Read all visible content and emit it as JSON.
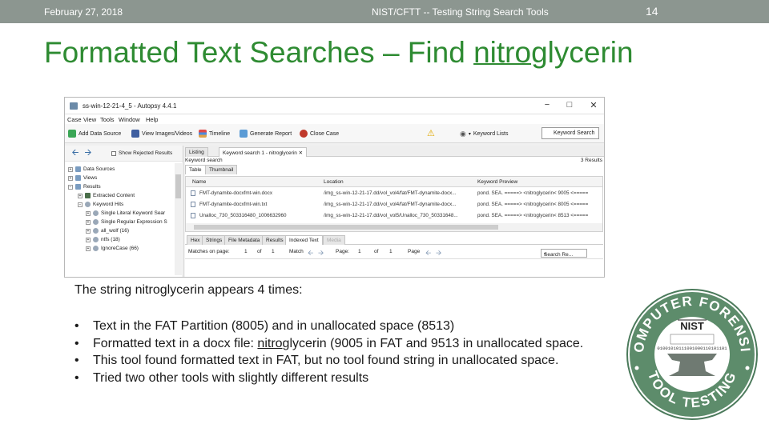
{
  "header": {
    "date": "February 27, 2018",
    "center_text": "NIST/CFTT -- Testing String Search Tools",
    "page_number": "14"
  },
  "title": {
    "prefix": "Formatted Text Searches – Find ",
    "underlined": "nitro",
    "suffix": "glycerin",
    "color": "#2e8b32"
  },
  "autopsy": {
    "window_title": "ss-win-12-21-4_5 - Autopsy 4.4.1",
    "window_controls": [
      "−",
      "□",
      "✕"
    ],
    "menu": [
      "Case",
      "View",
      "Tools",
      "Window",
      "Help"
    ],
    "toolbar": {
      "add_data_source": "Add Data Source",
      "view_images_videos": "View Images/Videos",
      "timeline": "Timeline",
      "generate_report": "Generate Report",
      "close_case": "Close Case",
      "keyword_lists": "Keyword Lists",
      "keyword_search": "Keyword Search"
    },
    "left_pane": {
      "show_rejected": "Show Rejected Results",
      "tree": [
        {
          "label": "Data Sources",
          "icon": "database-icon"
        },
        {
          "label": "Views",
          "icon": "views-icon"
        },
        {
          "label": "Results",
          "icon": "results-icon"
        },
        {
          "label": "Extracted Content",
          "icon": "folder-icon"
        },
        {
          "label": "Keyword Hits",
          "icon": "magnifier-icon"
        },
        {
          "label": "Single Literal Keyword Sear",
          "icon": "magnifier-icon"
        },
        {
          "label": "Single Regular Expression S",
          "icon": "magnifier-icon"
        },
        {
          "label": "all_wolf (16)",
          "icon": "magnifier-icon"
        },
        {
          "label": "ntfs (18)",
          "icon": "magnifier-icon"
        },
        {
          "label": "IgnoreCase (66)",
          "icon": "magnifier-icon"
        }
      ]
    },
    "result_tabs": [
      "Listing",
      "Keyword search 1 - nitroglycerin"
    ],
    "keyword_search_label": "Keyword search",
    "results_count": "3 Results",
    "view_tabs": [
      "Table",
      "Thumbnail"
    ],
    "table": {
      "columns": [
        "Name",
        "Location",
        "Keyword Preview"
      ],
      "rows": [
        {
          "name": "FMT-dynamite-docxfmt-win.docx",
          "location": "/img_ss-win-12-21-17.dd/vol_vol4/fat/FMT-dynamite-docx...",
          "preview": "pond. SEA. =====> <nitroglycerin< 9005 <====="
        },
        {
          "name": "FMT-dynamite-docxfmt-win.txt",
          "location": "/img_ss-win-12-21-17.dd/vol_vol4/fat/FMT-dynamite-docx...",
          "preview": "pond. SEA. =====> <nitroglycerin< 8005 <====="
        },
        {
          "name": "Unalloc_730_503316480_1006632960",
          "location": "/img_ss-win-12-21-17.dd/vol_vol5/Unalloc_730_50331648...",
          "preview": "pond. SEA. =====> <nitroglycerin< 8513 <====="
        }
      ]
    },
    "content_tabs": [
      "Hex",
      "Strings",
      "File Metadata",
      "Results",
      "Indexed Text",
      "Media"
    ],
    "match_row": {
      "matches_on_page": "Matches on page:",
      "m_current": "1",
      "of1": "of",
      "m_total": "1",
      "match": "Match",
      "page_label": "Page:",
      "p_current": "1",
      "of2": "of",
      "p_total": "1",
      "page": "Page",
      "search_results": "Search Re..."
    }
  },
  "body": {
    "intro": "The string nitroglycerin appears 4 times:",
    "bullets": [
      {
        "text": "Text in the FAT Partition (8005) and in unallocated space (8513)"
      },
      {
        "pre": "Formatted text in a docx file: ",
        "underlined": "nitro",
        "post": "glycerin (9005 in FAT and 9513 in unallocated space."
      },
      {
        "text": "This tool found formatted text in FAT, but no tool found string in unallocated space."
      },
      {
        "text": "Tried two other tools with slightly different results"
      }
    ]
  },
  "seal": {
    "top_text": "COMPUTER FORENSIC",
    "bottom_text": "TOOL TESTING",
    "center_logo": "NIST",
    "binary": "01001010111001000110101101"
  }
}
